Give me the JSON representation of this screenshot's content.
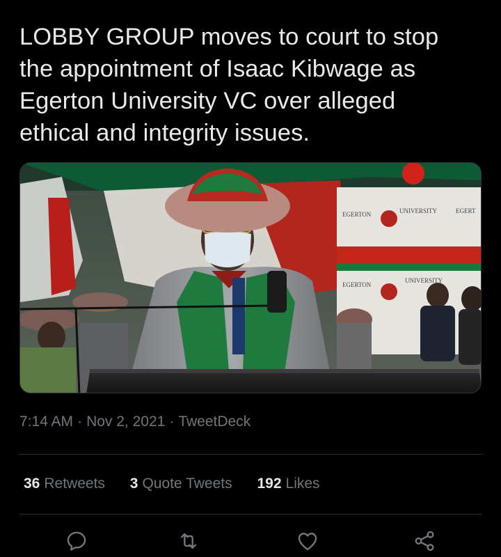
{
  "tweet": {
    "text_lines": [
      "LOBBY GROUP moves to court to stop",
      "the appointment of Isaac Kibwage as",
      "Egerton University VC over alleged",
      "ethical and integrity issues."
    ],
    "time": "7:14 AM",
    "date": "Nov 2, 2021",
    "source": "TweetDeck",
    "separator": "·"
  },
  "media": {
    "banner_words": [
      "EGERTON",
      "UNIVERSITY",
      "EGERT",
      "EGERTON",
      "UNIVERSITY"
    ]
  },
  "stats": {
    "retweets_count": "36",
    "retweets_label": "Retweets",
    "quotes_count": "3",
    "quotes_label": "Quote Tweets",
    "likes_count": "192",
    "likes_label": "Likes"
  },
  "actions": [
    "reply-icon",
    "retweet-icon",
    "like-icon",
    "share-icon"
  ],
  "colors": {
    "background": "#000000",
    "text": "#e7e9ea",
    "secondary": "#71767b",
    "divider": "#2f3336"
  }
}
